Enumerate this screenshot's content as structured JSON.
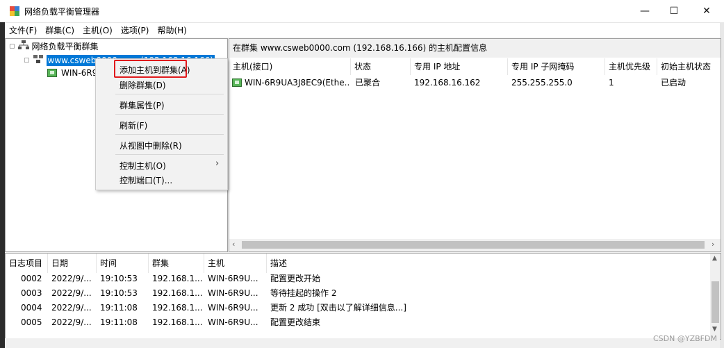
{
  "window": {
    "title": "网络负载平衡管理器",
    "controls": {
      "minimize": "—",
      "maximize": "☐",
      "close": "✕"
    }
  },
  "menubar": {
    "items": [
      "文件(F)",
      "群集(C)",
      "主机(O)",
      "选项(P)",
      "帮助(H)"
    ]
  },
  "tree": {
    "root": "网络负载平衡群集",
    "cluster": "www.csweb0000.com (192.168.16.166)",
    "host": "WIN-6R9"
  },
  "context_menu": {
    "items": [
      "添加主机到群集(A)",
      "删除群集(D)",
      "群集属性(P)",
      "刷新(F)",
      "从视图中删除(R)",
      "控制主机(O)",
      "控制端口(T)..."
    ],
    "submenu_arrow": "›"
  },
  "host_panel": {
    "header": "在群集 www.csweb0000.com (192.168.16.166) 的主机配置信息",
    "columns": [
      "主机(接口)",
      "状态",
      "专用 IP 地址",
      "专用 IP 子网掩码",
      "主机优先级",
      "初始主机状态"
    ],
    "rows": [
      [
        "WIN-6R9UA3J8EC9(Ethe...",
        "已聚合",
        "192.168.16.162",
        "255.255.255.0",
        "1",
        "已启动"
      ]
    ]
  },
  "log_panel": {
    "columns": [
      "日志项目",
      "日期",
      "时间",
      "群集",
      "主机",
      "描述"
    ],
    "rows": [
      [
        "0002",
        "2022/9/...",
        "19:10:53",
        "192.168.1...",
        "WIN-6R9U...",
        "配置更改开始"
      ],
      [
        "0003",
        "2022/9/...",
        "19:10:53",
        "192.168.1...",
        "WIN-6R9U...",
        "等待挂起的操作 2"
      ],
      [
        "0004",
        "2022/9/...",
        "19:11:08",
        "192.168.1...",
        "WIN-6R9U...",
        "更新 2 成功 [双击以了解详细信息...]"
      ],
      [
        "0005",
        "2022/9/...",
        "19:11:08",
        "192.168.1...",
        "WIN-6R9U...",
        "配置更改结束"
      ]
    ]
  },
  "watermark": "CSDN @YZBFDM",
  "colors": {
    "selection": "#0078d7",
    "highlight_box": "#e0191c",
    "host_icon": "#58b558"
  }
}
